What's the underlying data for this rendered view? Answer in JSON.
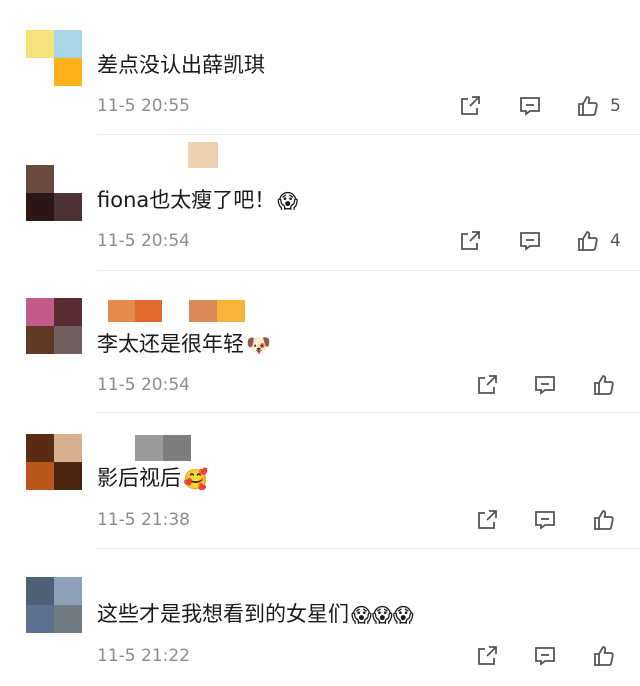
{
  "comments": [
    {
      "text": "差点没认出薛凯琪",
      "emoji": "",
      "time": "11-5 20:55",
      "likes": "5",
      "avatar_colors": [
        "#f6e27a",
        "#a9d3e6",
        "#ffffff",
        "#ffb21a"
      ],
      "name_blur_colors": []
    },
    {
      "text": "fiona也太瘦了吧！",
      "emoji": "😱",
      "time": "11-5 20:54",
      "likes": "4",
      "avatar_colors": [
        "#6b4a3f",
        "#ffffff",
        "#2a1716",
        "#4b3433"
      ],
      "name_blur_colors": [
        "#ecd2b0"
      ]
    },
    {
      "text": "李太还是很年轻",
      "emoji": "🐶",
      "time": "11-5 20:54",
      "likes": "",
      "avatar_colors": [
        "#c25b8c",
        "#5a2c30",
        "#603926",
        "#6f5f5f"
      ],
      "name_blur_colors": [
        "#e58a4a",
        "#e06a2a",
        "#d98a56",
        "#f4b43a"
      ]
    },
    {
      "text": "影后视后",
      "emoji": "🥰",
      "time": "11-5 21:38",
      "likes": "",
      "avatar_colors": [
        "#5a2c15",
        "#d9b08f",
        "#b9561b",
        "#4b2510"
      ],
      "name_blur_colors": [
        "#9a9a9a",
        "#7c7c7c"
      ]
    },
    {
      "text": "这些才是我想看到的女星们",
      "emoji": "😱😱😱",
      "time": "11-5 21:22",
      "likes": "",
      "avatar_colors": [
        "#4e6174",
        "#8ea1b8",
        "#5d7090",
        "#6f7c86"
      ],
      "name_blur_colors": []
    }
  ],
  "icons": {
    "share": "share-icon",
    "comment": "comment-icon",
    "like": "thumbs-up-icon"
  }
}
